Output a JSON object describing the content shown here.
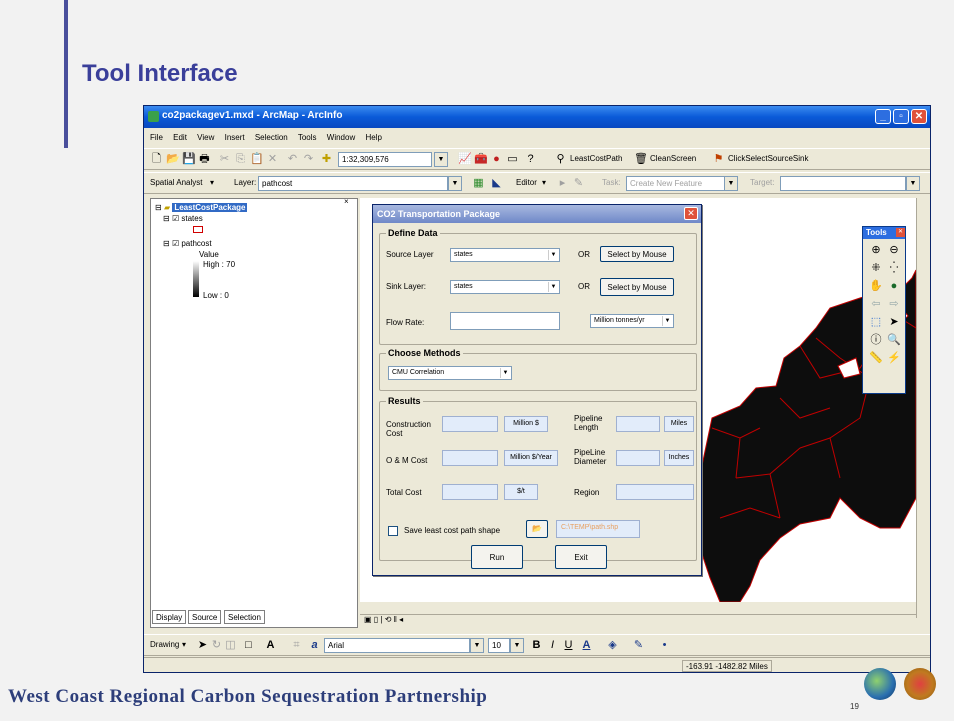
{
  "slide": {
    "title": "Tool Interface",
    "footer": "West Coast Regional Carbon Sequestration Partnership",
    "page_number": "19"
  },
  "window": {
    "title": "co2packagev1.mxd - ArcMap - ArcInfo"
  },
  "menu": [
    "File",
    "Edit",
    "View",
    "Insert",
    "Selection",
    "Tools",
    "Window",
    "Help"
  ],
  "toolbar": {
    "scale": "1:32,309,576",
    "least_cost_path": "LeastCostPath",
    "clean_screen": "CleanScreen",
    "click_select": "ClickSelectSourceSink"
  },
  "toolbar2": {
    "spatial_analyst": "Spatial Analyst",
    "layer_label": "Layer:",
    "layer_value": "pathcost",
    "editor": "Editor",
    "task_label": "Task:",
    "task_value": "Create New Feature",
    "target_label": "Target:"
  },
  "toc": {
    "root": "LeastCostPackage",
    "states": "states",
    "pathcost": "pathcost",
    "value": "Value",
    "high": "High : 70",
    "low": "Low : 0",
    "tabs": [
      "Display",
      "Source",
      "Selection"
    ]
  },
  "drawing": {
    "drawing": "Drawing",
    "font": "Arial",
    "size": "10"
  },
  "status": {
    "coords": "-163.91  -1482.82 Miles"
  },
  "dialog": {
    "title": "CO2 Transportation Package",
    "define_data": "Define Data",
    "source_layer_label": "Source Layer",
    "source_layer_value": "states",
    "sink_layer_label": "Sink Layer:",
    "sink_layer_value": "states",
    "or": "OR",
    "select_by_mouse": "Select by Mouse",
    "flow_rate_label": "Flow Rate:",
    "flow_unit": "Million tonnes/yr",
    "choose_methods": "Choose Methods",
    "method": "CMU Correlation",
    "results": "Results",
    "construction_cost": "Construction Cost",
    "construction_unit": "Million $",
    "pipeline_length": "Pipeline Length",
    "pipeline_length_unit": "Miles",
    "om_cost": "O & M Cost",
    "om_unit": "Million $/Year",
    "pipeline_diameter": "PipeLine Diameter",
    "diameter_unit": "Inches",
    "total_cost": "Total Cost",
    "total_unit": "$/t",
    "region": "Region",
    "save_label": "Save least cost path shape",
    "save_path": "C:\\TEMP\\path.shp",
    "run": "Run",
    "exit": "Exit"
  },
  "tools_palette": {
    "title": "Tools"
  }
}
